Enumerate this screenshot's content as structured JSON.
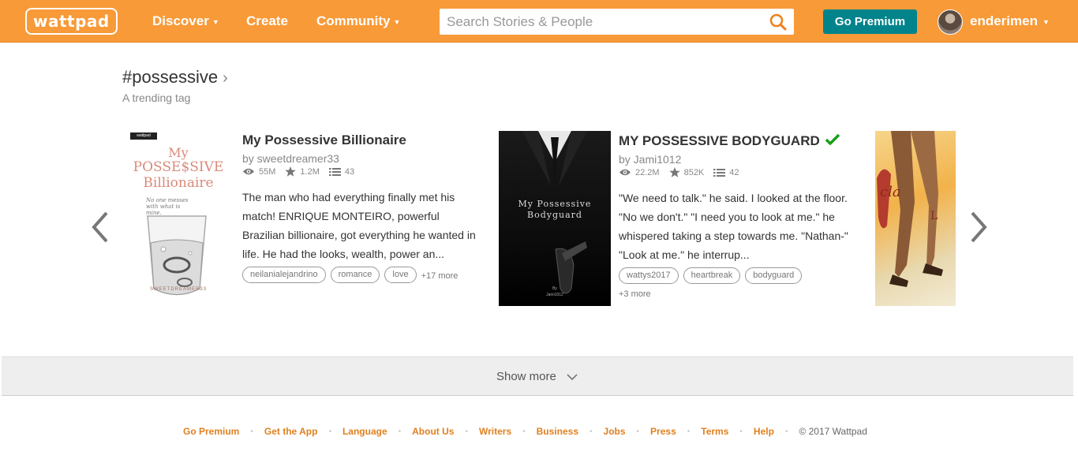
{
  "header": {
    "logo": "wattpad",
    "nav": [
      {
        "label": "Discover",
        "caret": true
      },
      {
        "label": "Create",
        "caret": false
      },
      {
        "label": "Community",
        "caret": true
      }
    ],
    "search_placeholder": "Search Stories & People",
    "premium_label": "Go Premium",
    "username": "enderimen"
  },
  "tag_section": {
    "title": "#possessive",
    "subtitle": "A trending tag"
  },
  "stories": [
    {
      "title": "My Possessive Billionaire",
      "author": "by sweetdreamer33",
      "reads": "55M",
      "votes": "1.2M",
      "parts": "43",
      "description": "The man who had everything finally met his match! ENRIQUE MONTEIRO, powerful Brazilian billionaire, got everything he wanted in life. He had the looks, wealth, power an...",
      "tags": [
        "neilanialejandrino",
        "romance",
        "love"
      ],
      "more_tags": "+17 more",
      "cover_text": {
        "top": "wattpad",
        "line1": "My",
        "line2": "POSSE$SIVE",
        "line3": "Billionaire",
        "tag": "No one messes with what is mine.",
        "bottom": "SWEETDREAMER33"
      }
    },
    {
      "title": "MY POSSESSIVE BODYGUARD",
      "verified": true,
      "author": "by Jami1012",
      "reads": "22.2M",
      "votes": "852K",
      "parts": "42",
      "description": "\"We need to talk.\" he said. I looked at the floor. \"No we don't.\" \"I need you to look at me.\" he whispered taking a step towards me. \"Nathan-\" \"Look at me.\" he interrup...",
      "tags": [
        "wattys2017",
        "heartbreak",
        "bodyguard"
      ],
      "more_tags": "+3 more",
      "cover_text": {
        "line1": "My Possessive",
        "line2": "Bodyguard",
        "by": "By",
        "bottom": "Jami1012"
      }
    }
  ],
  "show_more": "Show more",
  "footer": {
    "links": [
      "Go Premium",
      "Get the App",
      "Language",
      "About Us",
      "Writers",
      "Business",
      "Jobs",
      "Press",
      "Terms",
      "Help"
    ],
    "copyright": "© 2017 Wattpad"
  },
  "colors": {
    "brand": "#f89a38",
    "premium": "#00838b",
    "link": "#e0801f"
  }
}
